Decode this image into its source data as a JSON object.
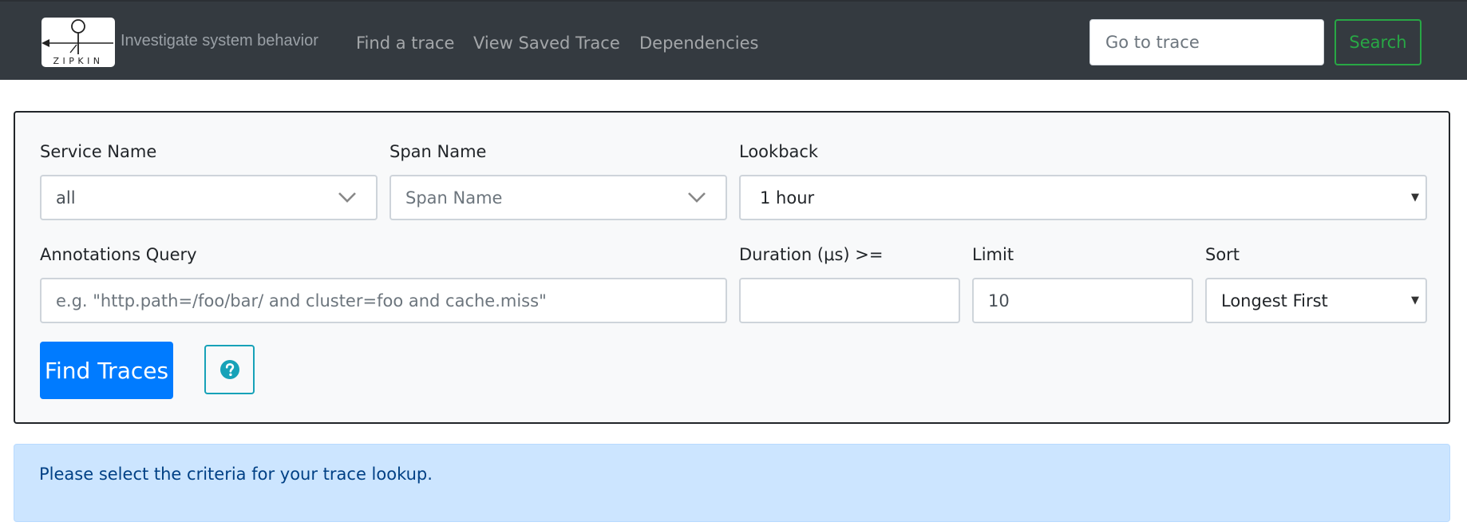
{
  "header": {
    "logo_text": "ZIPKIN",
    "tagline": "Investigate system behavior",
    "nav": [
      {
        "label": "Find a trace"
      },
      {
        "label": "View Saved Trace"
      },
      {
        "label": "Dependencies"
      }
    ],
    "goto_placeholder": "Go to trace",
    "search_label": "Search"
  },
  "form": {
    "service_name": {
      "label": "Service Name",
      "value": "all"
    },
    "span_name": {
      "label": "Span Name",
      "placeholder": "Span Name"
    },
    "lookback": {
      "label": "Lookback",
      "value": "1 hour"
    },
    "annotations": {
      "label": "Annotations Query",
      "placeholder": "e.g. \"http.path=/foo/bar/ and cluster=foo and cache.miss\""
    },
    "duration": {
      "label": "Duration (μs) >=",
      "value": ""
    },
    "limit": {
      "label": "Limit",
      "value": "10"
    },
    "sort": {
      "label": "Sort",
      "value": "Longest First"
    },
    "find_label": "Find Traces",
    "help_icon": "question-circle-icon"
  },
  "alert": {
    "message": "Please select the criteria for your trace lookup."
  },
  "colors": {
    "navbar": "#343a40",
    "primary": "#007bff",
    "success": "#28a745",
    "info": "#17a2b8",
    "alert_bg": "#cce5ff"
  }
}
